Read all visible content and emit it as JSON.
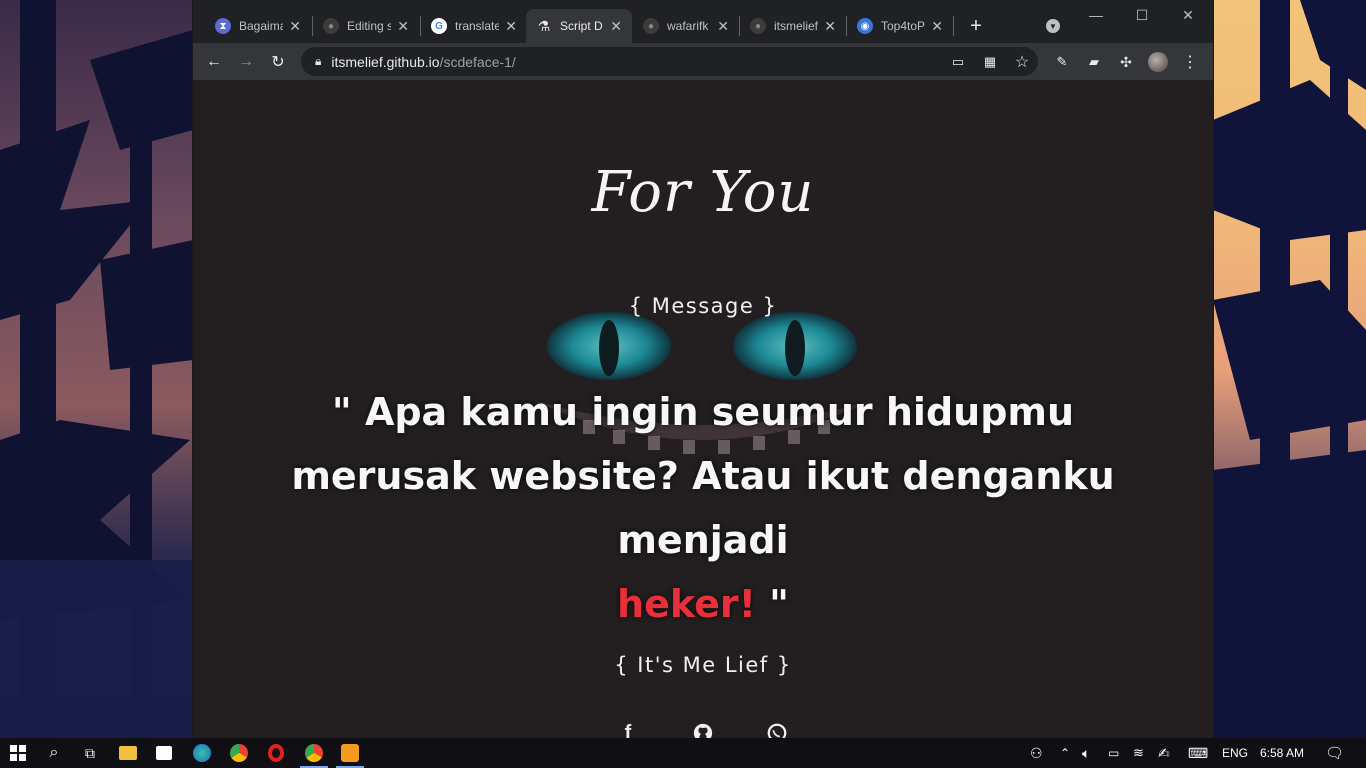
{
  "browser": {
    "tabs": [
      {
        "title": "Bagaima",
        "fav_color": "#5b6bd8",
        "fav_glyph": "⧗"
      },
      {
        "title": "Editing s",
        "fav_color": "#3c3c3c",
        "fav_glyph": "●"
      },
      {
        "title": "translate",
        "fav_color": "#ffffff",
        "fav_glyph": "G"
      },
      {
        "title": "Script D",
        "fav_color": "#e8eaed",
        "fav_glyph": "⚗"
      },
      {
        "title": "wafarifk",
        "fav_color": "#3c3c3c",
        "fav_glyph": "●"
      },
      {
        "title": "itsmelief",
        "fav_color": "#3c3c3c",
        "fav_glyph": "●"
      },
      {
        "title": "Top4toP",
        "fav_color": "#3b74d8",
        "fav_glyph": "◉"
      }
    ],
    "active_tab_index": 3,
    "new_tab_label": "+",
    "omnibox": {
      "host": "itsmelief.github.io",
      "path": "/scdeface-1/"
    }
  },
  "page": {
    "title": "For You",
    "message_label": "{ Message }",
    "quote_part1": "\" Apa kamu ingin seumur hidupmu merusak website? Atau ikut denganku menjadi",
    "quote_highlight": "heker!",
    "quote_end": " \"",
    "signature": "{ It's Me Lief }",
    "social_icons": [
      "facebook-icon",
      "github-icon",
      "whatsapp-icon"
    ],
    "highlight_color": "#e8303a"
  },
  "taskbar": {
    "language": "ENG",
    "time": "6:58 AM"
  }
}
